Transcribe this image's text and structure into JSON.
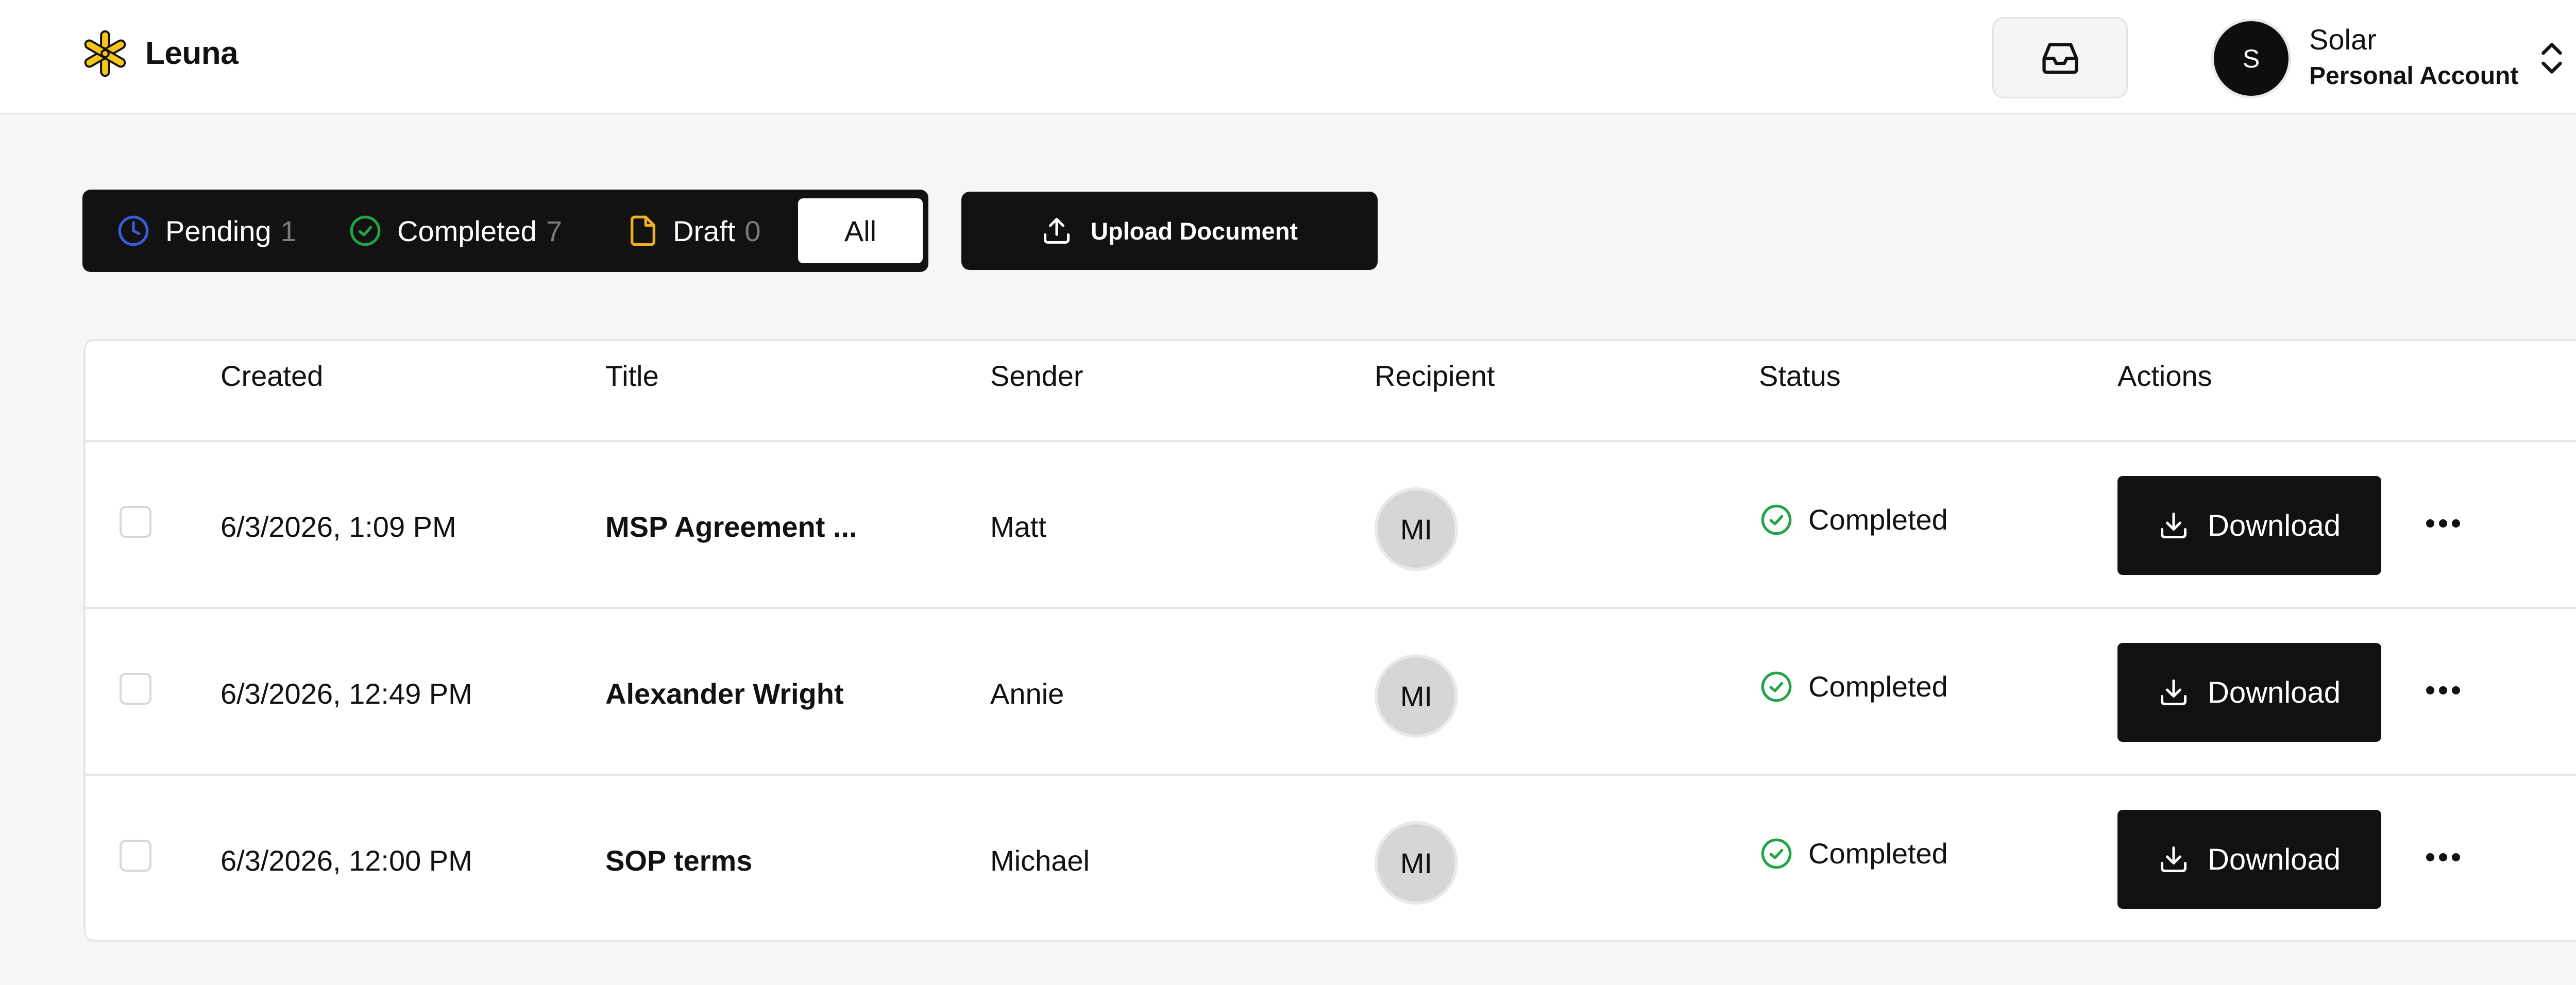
{
  "brand": {
    "name": "Leuna"
  },
  "account": {
    "avatar_initial": "S",
    "name": "Solar",
    "type": "Personal Account"
  },
  "filters": {
    "items": [
      {
        "label": "Pending",
        "count": "1",
        "icon": "clock-icon",
        "color": "#3B5BDB"
      },
      {
        "label": "Completed",
        "count": "7",
        "icon": "check-circle-icon",
        "color": "#22A447"
      },
      {
        "label": "Draft",
        "count": "0",
        "icon": "file-icon",
        "color": "#F2B01E"
      }
    ],
    "all_label": "All"
  },
  "upload": {
    "label": "Upload Document"
  },
  "table": {
    "headers": [
      "Created",
      "Title",
      "Sender",
      "Recipient",
      "Status",
      "Actions"
    ],
    "rows": [
      {
        "created": "6/3/2026, 1:09 PM",
        "title": "MSP Agreement ...",
        "sender": "Matt",
        "recipient": "MI",
        "status": "Completed",
        "action": "Download"
      },
      {
        "created": "6/3/2026, 12:49 PM",
        "title": "Alexander Wright",
        "sender": "Annie",
        "recipient": "MI",
        "status": "Completed",
        "action": "Download"
      },
      {
        "created": "6/3/2026, 12:00 PM",
        "title": "SOP terms",
        "sender": "Michael",
        "recipient": "MI",
        "status": "Completed",
        "action": "Download"
      }
    ]
  },
  "colors": {
    "accent_dark": "#111111",
    "status_completed": "#22A447",
    "background": "#F6F6F4"
  }
}
